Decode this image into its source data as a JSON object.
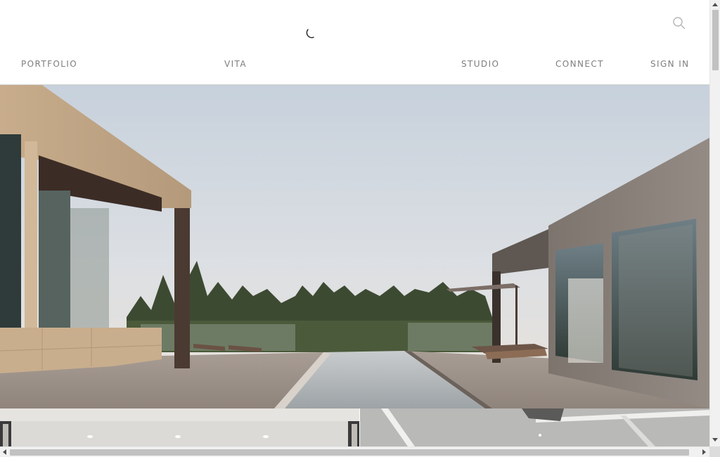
{
  "header": {
    "logo_icon": "loading-spinner-icon",
    "search_icon": "search-icon"
  },
  "nav": {
    "items": [
      {
        "label": "PORTFOLIO"
      },
      {
        "label": "VITA"
      },
      {
        "label": "STUDIO"
      },
      {
        "label": "CONNECT"
      },
      {
        "label": "SIGN IN"
      }
    ]
  },
  "colors": {
    "nav_text": "#7d7d7d",
    "header_border": "#cfcfcf",
    "background": "#ffffff"
  },
  "scrollbars": {
    "vertical": {
      "up_icon": "arrow-up-icon",
      "down_icon": "arrow-down-icon"
    },
    "horizontal": {
      "left_icon": "arrow-left-icon",
      "right_icon": "arrow-right-icon"
    }
  }
}
